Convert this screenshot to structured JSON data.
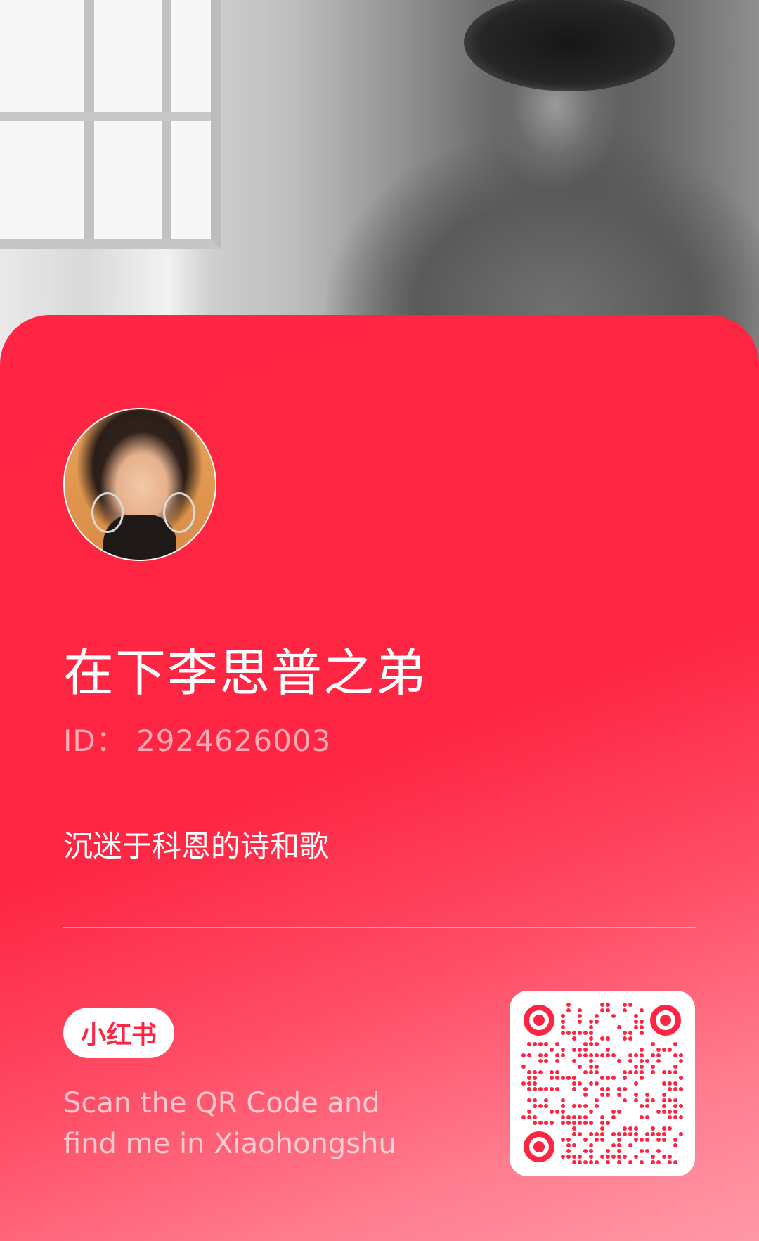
{
  "profile": {
    "nickname": "在下李思普之弟",
    "id_text": "ID：  2924626003",
    "bio": "沉迷于科恩的诗和歌"
  },
  "brand": {
    "logo_text": "小红书",
    "tagline_line1": "Scan the QR Code and",
    "tagline_line2": "find me in Xiaohongshu"
  },
  "colors": {
    "card_red": "#ff2442",
    "text_white": "#ffffff"
  },
  "icons": {
    "qr_code": "qr-code-icon",
    "avatar": "avatar-image"
  }
}
